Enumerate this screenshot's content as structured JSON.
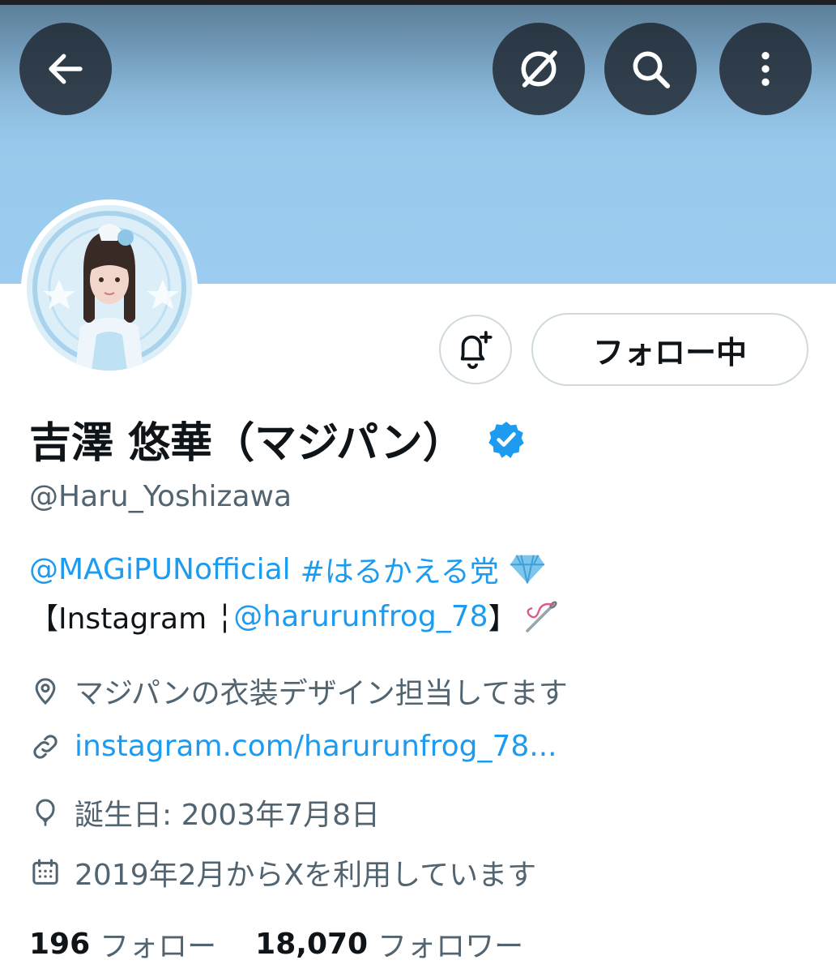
{
  "header": {
    "back_icon": "arrow-left-icon",
    "grok_icon": "grok-icon",
    "search_icon": "search-icon",
    "more_icon": "more-vertical-icon"
  },
  "profile": {
    "display_name": "吉澤 悠華（マジパン）",
    "handle": "@Haru_Yoshizawa",
    "verified": true,
    "follow_button_label": "フォロー中",
    "notify_icon": "bell-plus-icon"
  },
  "bio": {
    "mention": "@MAGiPUNofficial",
    "hashtag": "#はるかえる党",
    "line2_prefix": "【Instagram ╎ ",
    "line2_mention": "@harurunfrog_78",
    "line2_suffix": "】"
  },
  "meta": {
    "location": "マジパンの衣装デザイン担当してます",
    "website": "instagram.com/harurunfrog_78...",
    "birthday": "誕生日: 2003年7月8日",
    "joined": "2019年2月からXを利用しています"
  },
  "stats": {
    "following_count": "196",
    "following_label": "フォロー",
    "followers_count": "18,070",
    "followers_label": "フォロワー"
  },
  "colors": {
    "link": "#1d9bf0",
    "secondary_text": "#536471",
    "banner": "#9ccdf0"
  }
}
